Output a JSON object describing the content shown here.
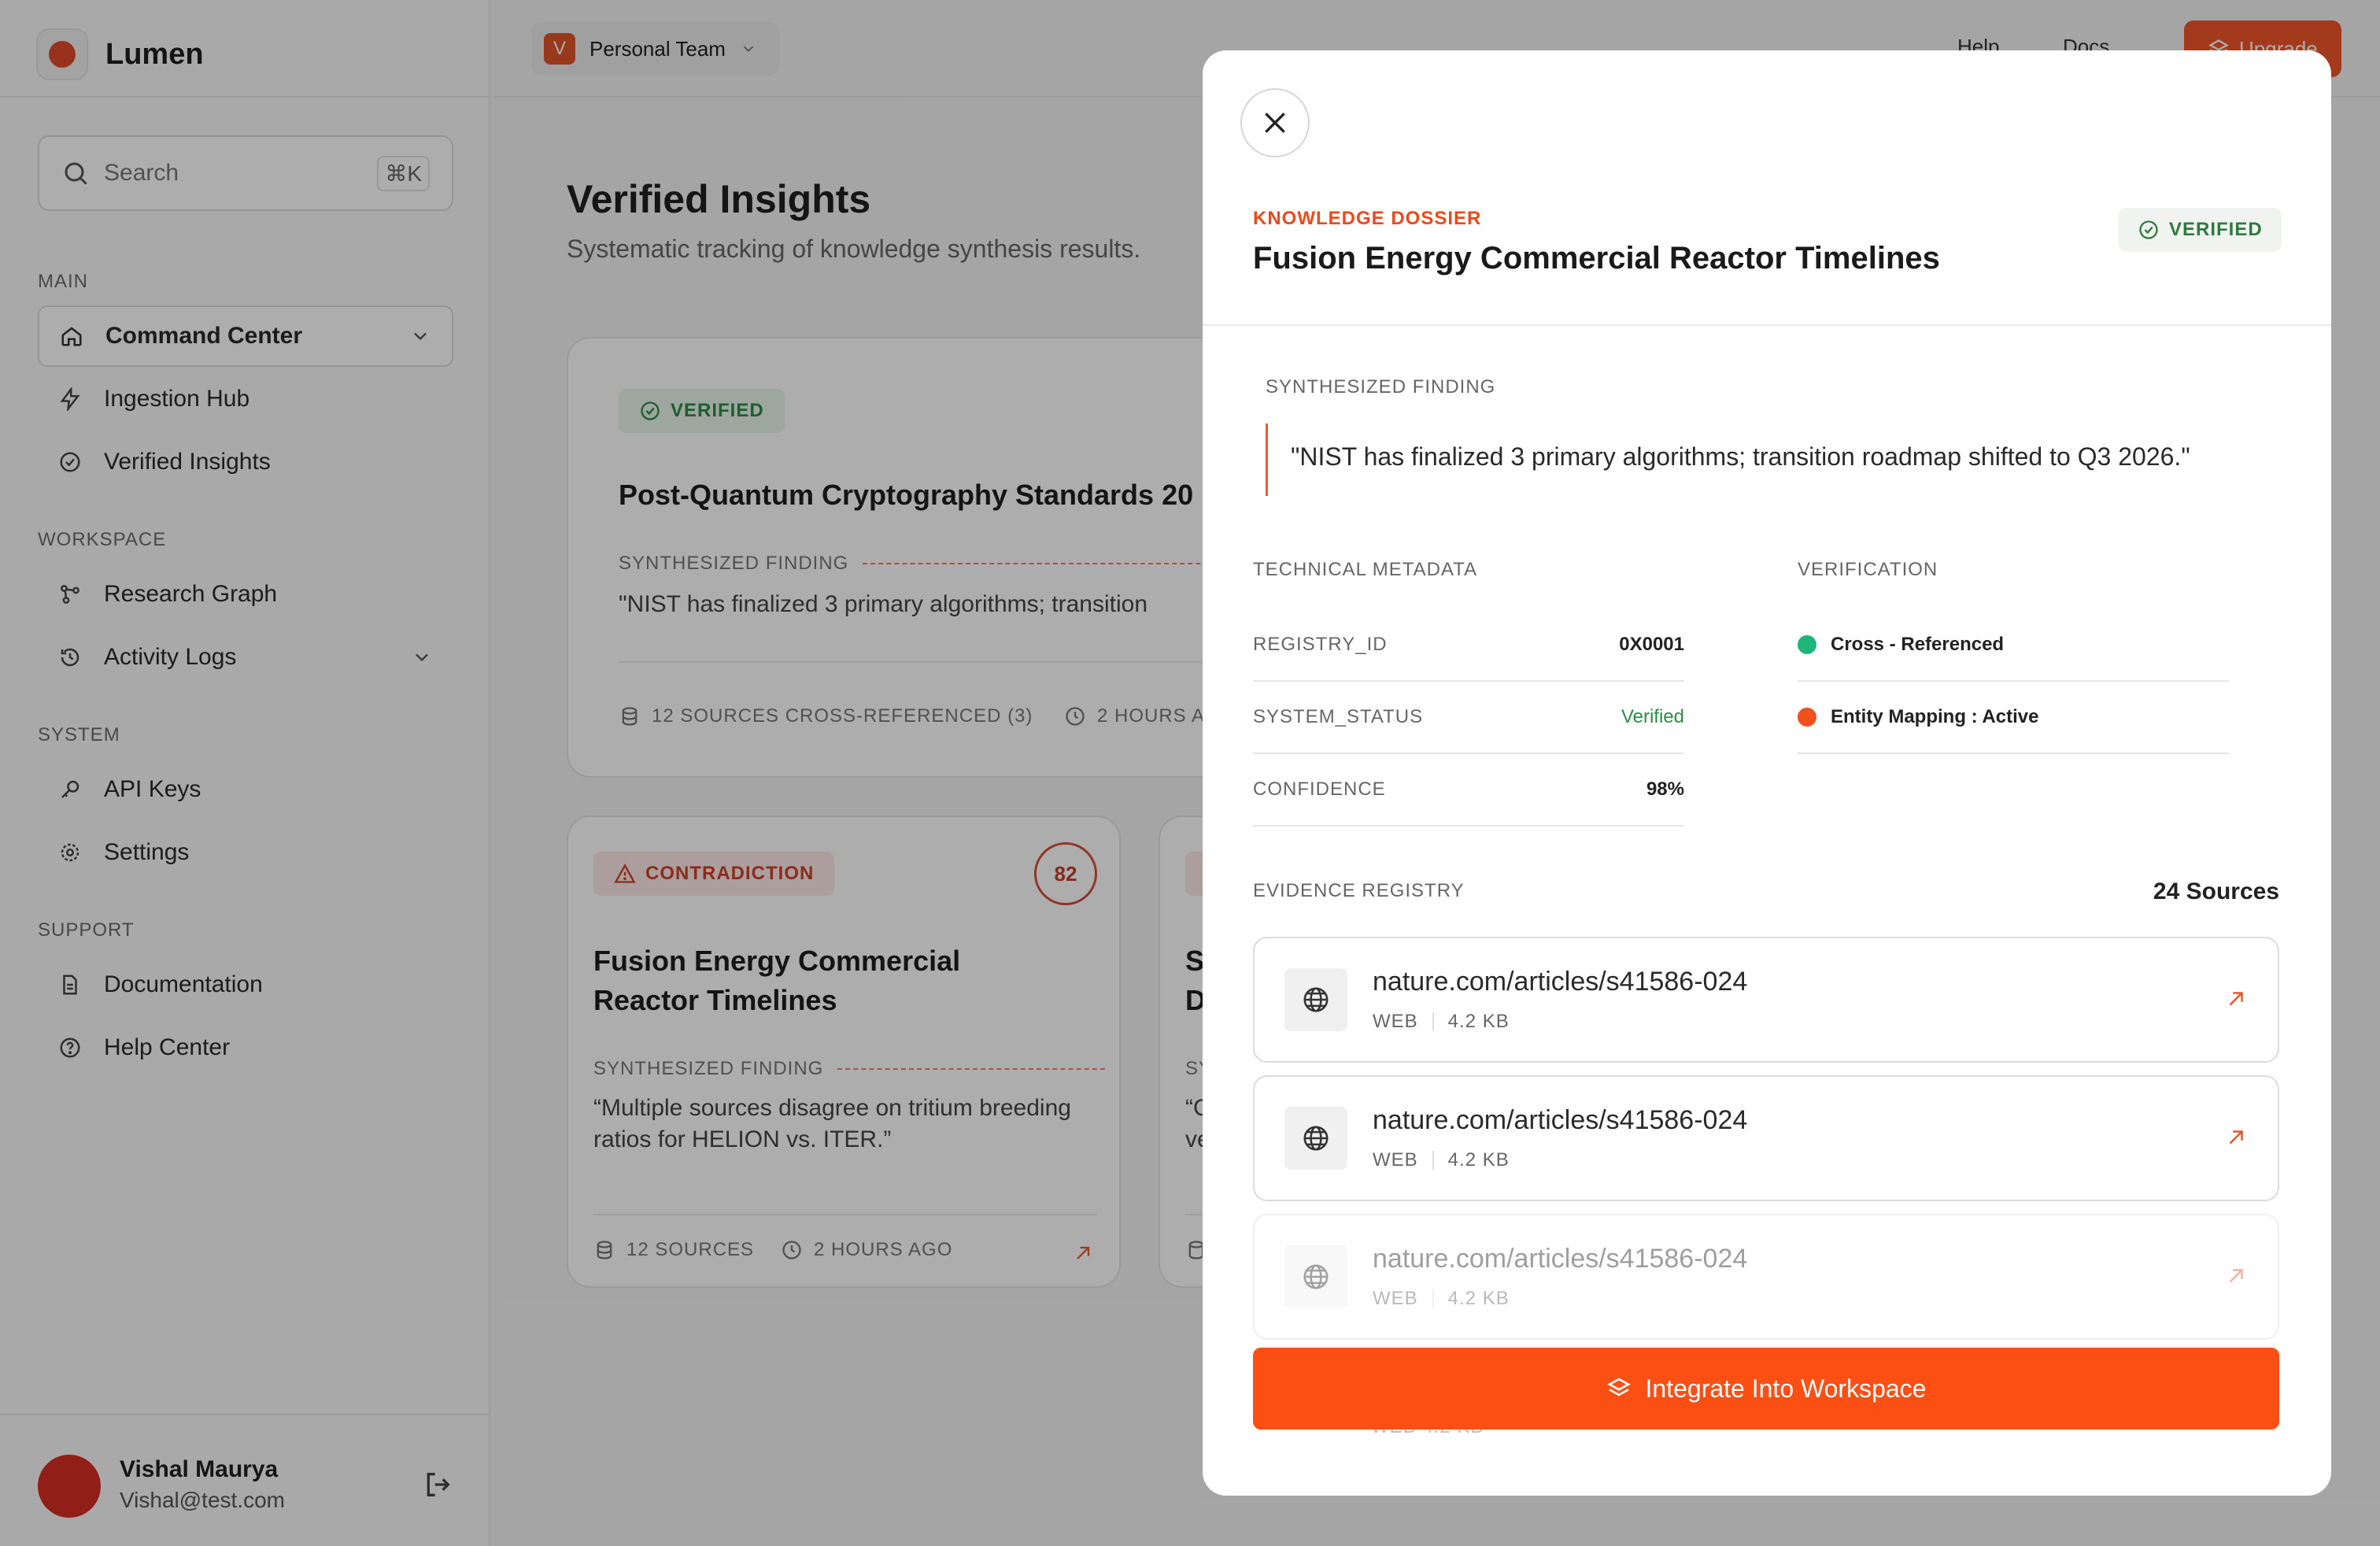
{
  "app": {
    "name": "Lumen"
  },
  "sidebar": {
    "search_placeholder": "Search",
    "search_shortcut": "⌘K",
    "groups": [
      {
        "label": "MAIN"
      },
      {
        "label": "WORKSPACE"
      },
      {
        "label": "SYSTEM"
      },
      {
        "label": "SUPPORT"
      }
    ],
    "items": [
      {
        "label": "Command Center",
        "icon": "home-icon",
        "active": true,
        "expandable": true
      },
      {
        "label": "Ingestion Hub",
        "icon": "bolt-icon"
      },
      {
        "label": "Verified Insights",
        "icon": "badge-check-icon"
      },
      {
        "label": "Research Graph",
        "icon": "graph-icon"
      },
      {
        "label": "Activity Logs",
        "icon": "history-icon",
        "expandable": true
      },
      {
        "label": "API Keys",
        "icon": "key-icon"
      },
      {
        "label": "Settings",
        "icon": "gear-icon"
      },
      {
        "label": "Documentation",
        "icon": "document-icon"
      },
      {
        "label": "Help Center",
        "icon": "help-circle-icon"
      }
    ],
    "user": {
      "name": "Vishal Maurya",
      "email": "Vishal@test.com"
    }
  },
  "topbar": {
    "team_initial": "V",
    "team_name": "Personal Team",
    "links": [
      "Help",
      "Docs"
    ],
    "upgrade_label": "Upgrade"
  },
  "page": {
    "title": "Verified Insights",
    "subtitle": "Systematic tracking of knowledge synthesis results."
  },
  "cards": [
    {
      "badge": "VERIFIED",
      "title": "Post-Quantum Cryptography Standards 20",
      "finding_label": "SYNTHESIZED FINDING",
      "finding": "\"NIST has finalized 3 primary algorithms; transition",
      "sources": "12 SOURCES CROSS-REFERENCED (3)",
      "time": "2 HOURS A"
    },
    {
      "badge": "CONTRADICTION",
      "score": "82",
      "title_line1": "Fusion Energy Commercial",
      "title_line2": "Reactor Timelines",
      "finding_label": "SYNTHESIZED FINDING",
      "finding_line1": "“Multiple sources disagree on tritium breeding",
      "finding_line2": "ratios for HELION vs. ITER.”",
      "sources": "12 SOURCES",
      "time": "2 HOURS AGO"
    },
    {
      "title_line1": "S",
      "title_line2": "D",
      "finding_label": "SY",
      "finding_line1": "“C",
      "finding_line2": "ve"
    }
  ],
  "modal": {
    "eyebrow": "KNOWLEDGE DOSSIER",
    "title": "Fusion Energy Commercial Reactor Timelines",
    "badge": "VERIFIED",
    "finding_label": "SYNTHESIZED FINDING",
    "finding": "\"NIST has finalized 3 primary algorithms; transition roadmap shifted to Q3 2026.\"",
    "tech_label": "TECHNICAL METADATA",
    "metadata": [
      {
        "key": "REGISTRY_ID",
        "value": "0X0001"
      },
      {
        "key": "SYSTEM_STATUS",
        "value": "Verified"
      },
      {
        "key": "CONFIDENCE",
        "value": "98%"
      }
    ],
    "verification_label": "VERIFICATION",
    "verification": [
      {
        "label": "Cross - Referenced",
        "color": "#1fb47a"
      },
      {
        "label": "Entity Mapping : Active",
        "color": "#f0501e"
      }
    ],
    "evidence_label": "EVIDENCE REGISTRY",
    "sources_count": "24 Sources",
    "evidence": [
      {
        "url": "nature.com/articles/s41586-024",
        "type": "WEB",
        "size": "4.2 KB"
      },
      {
        "url": "nature.com/articles/s41586-024",
        "type": "WEB",
        "size": "4.2 KB"
      },
      {
        "url": "nature.com/articles/s41586-024",
        "type": "WEB",
        "size": "4.2 KB"
      }
    ],
    "faint_row": "WEB    4.2 KB",
    "integrate_label": "Integrate Into Workspace"
  },
  "colors": {
    "accent": "#fb4f14",
    "verified": "#2e8a45",
    "contradiction": "#d0402a"
  }
}
